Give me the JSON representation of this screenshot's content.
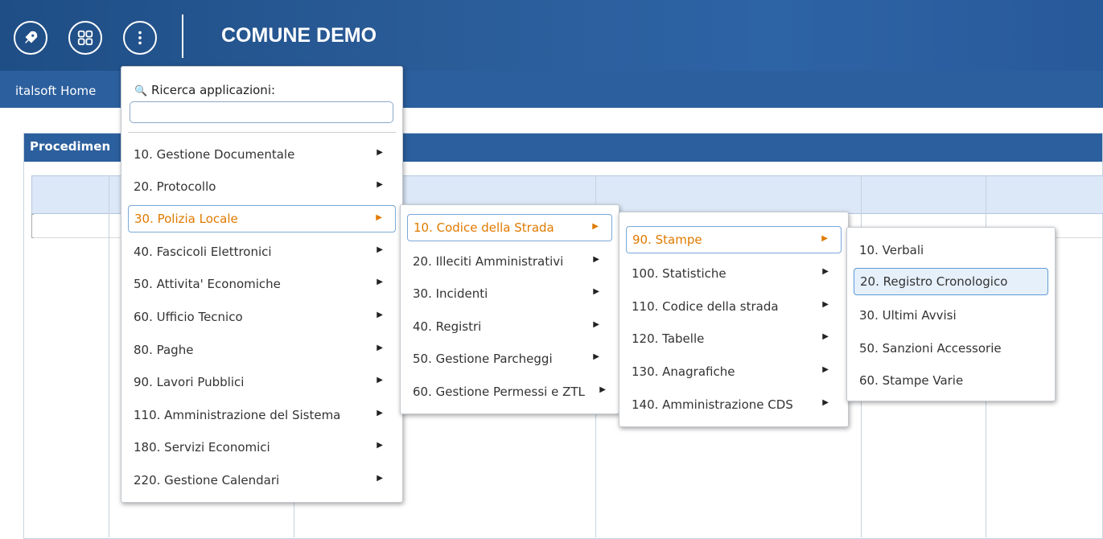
{
  "header": {
    "title": "COMUNE DEMO",
    "icons": [
      "rocket-icon",
      "apps-grid-icon",
      "more-vertical-icon"
    ]
  },
  "navbar": {
    "home": "italsoft Home"
  },
  "panel": {
    "title": "Procedimen"
  },
  "menu1": {
    "search_label": "Ricerca applicazioni:",
    "search_value": "",
    "items": [
      "10. Gestione Documentale",
      "20. Protocollo",
      "30. Polizia Locale",
      "40. Fascicoli Elettronici",
      "50. Attivita' Economiche",
      "60. Ufficio Tecnico",
      "80. Paghe",
      "90. Lavori Pubblici",
      "110. Amministrazione del Sistema",
      "180. Servizi Economici",
      "220. Gestione Calendari"
    ]
  },
  "menu2": {
    "items": [
      "10. Codice della Strada",
      "20. Illeciti Amministrativi",
      "30. Incidenti",
      "40. Registri",
      "50. Gestione Parcheggi",
      "60. Gestione Permessi e ZTL"
    ]
  },
  "menu3": {
    "items": [
      "90. Stampe",
      "100. Statistiche",
      "110. Codice della strada",
      "120. Tabelle",
      "130. Anagrafiche",
      "140. Amministrazione CDS"
    ]
  },
  "menu4": {
    "items": [
      "10. Verbali",
      "20. Registro Cronologico",
      "30. Ultimi Avvisi",
      "50. Sanzioni Accessorie",
      "60. Stampe Varie"
    ]
  },
  "colors": {
    "header": "#2c5f9d",
    "active_text": "#e07a00",
    "hover_bg": "#e6f0fb"
  }
}
